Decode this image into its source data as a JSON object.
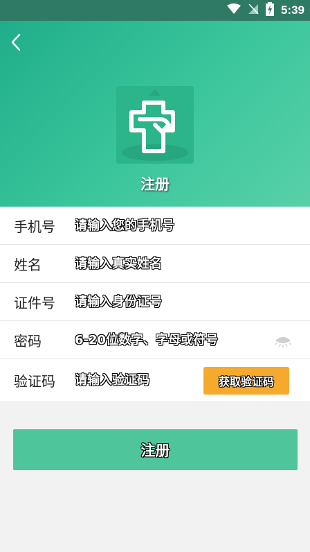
{
  "status_bar": {
    "time": "5:39"
  },
  "header": {
    "title": "注册"
  },
  "form": {
    "phone": {
      "label": "手机号",
      "placeholder": "请输入您的手机号"
    },
    "name": {
      "label": "姓名",
      "placeholder": "请输入真实姓名"
    },
    "id_number": {
      "label": "证件号",
      "placeholder": "请输入身份证号"
    },
    "password": {
      "label": "密码",
      "placeholder": "6-20位数字、字母或符号"
    },
    "code": {
      "label": "验证码",
      "placeholder": "请输入验证码",
      "button_label": "获取验证码"
    }
  },
  "submit": {
    "label": "注册"
  },
  "colors": {
    "primary": "#4fc59c",
    "accent": "#f6aa2d",
    "status_bar": "#2f7a64"
  }
}
